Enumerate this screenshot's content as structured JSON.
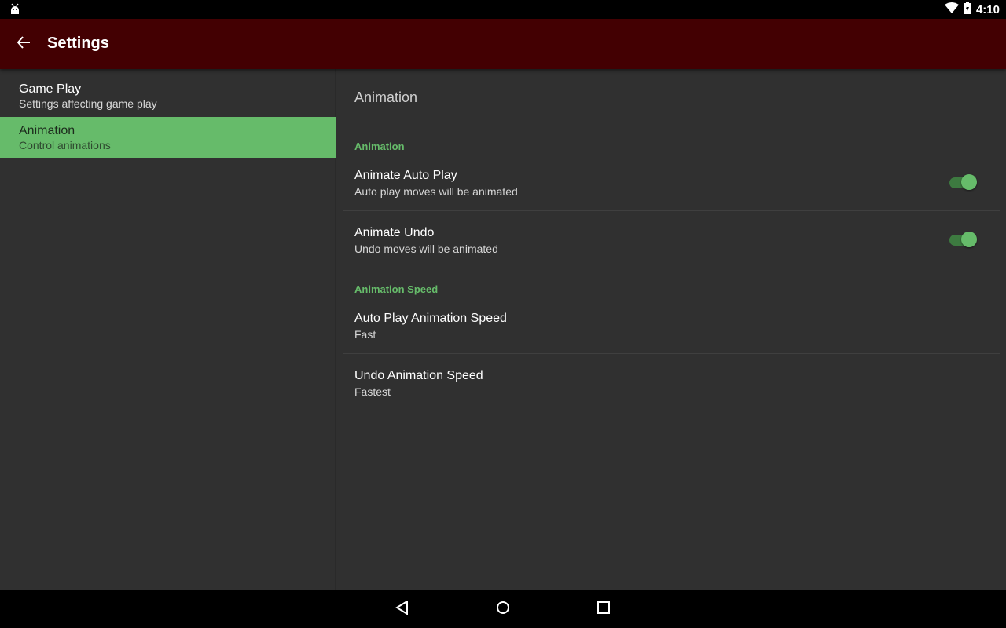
{
  "status_bar": {
    "time": "4:10",
    "left_icon": "android-debug-icon",
    "icons": [
      "wifi-icon",
      "battery-icon"
    ]
  },
  "app_bar": {
    "title": "Settings",
    "back_icon": "arrow-back-icon",
    "color": "#430002"
  },
  "headers": [
    {
      "title": "Game Play",
      "summary": "Settings affecting game play",
      "selected": false
    },
    {
      "title": "Animation",
      "summary": "Control animations",
      "selected": true
    }
  ],
  "detail": {
    "title": "Animation",
    "categories": [
      {
        "name": "Animation",
        "prefs": [
          {
            "title": "Animate Auto Play",
            "summary": "Auto play moves will be animated",
            "switch_on": true
          },
          {
            "title": "Animate Undo",
            "summary": "Undo moves will be animated",
            "switch_on": true
          }
        ]
      },
      {
        "name": "Animation Speed",
        "prefs": [
          {
            "title": "Auto Play Animation Speed",
            "summary": "Fast"
          },
          {
            "title": "Undo Animation Speed",
            "summary": "Fastest"
          }
        ]
      }
    ]
  },
  "nav_bar": {
    "icons": [
      "back-triangle-icon",
      "home-circle-icon",
      "recents-square-icon"
    ]
  },
  "colors": {
    "accent": "#66bb6a",
    "background": "#303030",
    "app_bar": "#430002"
  }
}
